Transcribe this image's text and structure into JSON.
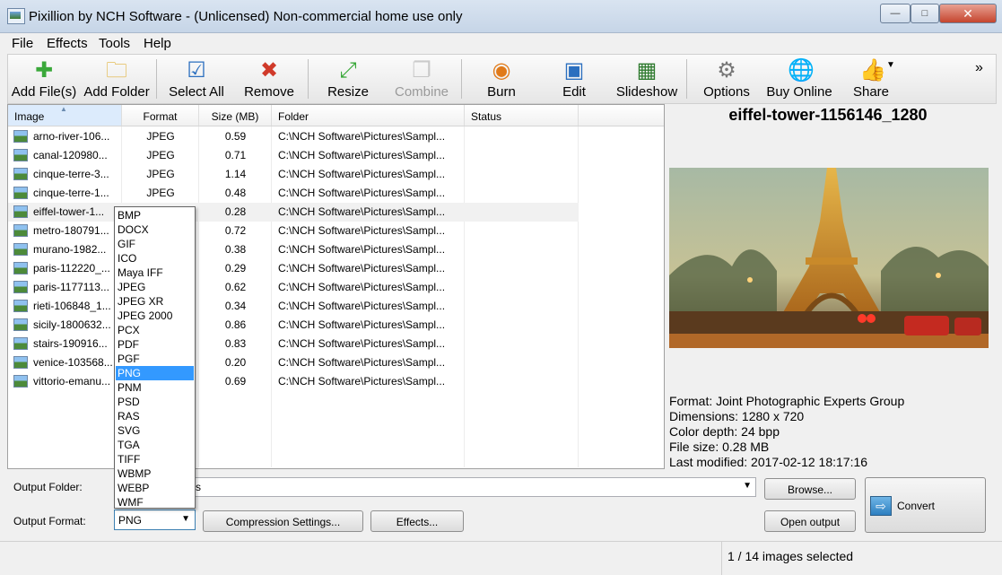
{
  "window": {
    "title": "Pixillion by NCH Software - (Unlicensed) Non-commercial home use only",
    "btn_min": "—",
    "btn_max": "□",
    "btn_close": "✕"
  },
  "menu": [
    "File",
    "Effects",
    "Tools",
    "Help"
  ],
  "toolbar": {
    "items": [
      {
        "label": "Add File(s)",
        "icon": "add-icon",
        "enabled": true
      },
      {
        "label": "Add Folder",
        "icon": "folder-add-icon",
        "enabled": true
      },
      {
        "label": "Select All",
        "icon": "select-all-icon",
        "enabled": true
      },
      {
        "label": "Remove",
        "icon": "remove-icon",
        "enabled": true
      },
      {
        "label": "Resize",
        "icon": "resize-icon",
        "enabled": true
      },
      {
        "label": "Combine",
        "icon": "combine-icon",
        "enabled": false
      },
      {
        "label": "Burn",
        "icon": "burn-disc-icon",
        "enabled": true
      },
      {
        "label": "Edit",
        "icon": "edit-icon",
        "enabled": true
      },
      {
        "label": "Slideshow",
        "icon": "slideshow-icon",
        "enabled": true
      },
      {
        "label": "Options",
        "icon": "options-icon",
        "enabled": true
      },
      {
        "label": "Buy Online",
        "icon": "buy-online-icon",
        "enabled": true
      },
      {
        "label": "Share",
        "icon": "share-icon",
        "enabled": true
      }
    ],
    "overflow": "»"
  },
  "filelist": {
    "columns": [
      "Image",
      "Format",
      "Size (MB)",
      "Folder",
      "Status"
    ],
    "rows": [
      {
        "name": "arno-river-106...",
        "format": "JPEG",
        "size": "0.59",
        "folder": "C:\\NCH Software\\Pictures\\Sampl..."
      },
      {
        "name": "canal-120980...",
        "format": "JPEG",
        "size": "0.71",
        "folder": "C:\\NCH Software\\Pictures\\Sampl..."
      },
      {
        "name": "cinque-terre-3...",
        "format": "JPEG",
        "size": "1.14",
        "folder": "C:\\NCH Software\\Pictures\\Sampl..."
      },
      {
        "name": "cinque-terre-1...",
        "format": "JPEG",
        "size": "0.48",
        "folder": "C:\\NCH Software\\Pictures\\Sampl..."
      },
      {
        "name": "eiffel-tower-1...",
        "format": "",
        "size": "0.28",
        "folder": "C:\\NCH Software\\Pictures\\Sampl..."
      },
      {
        "name": "metro-180791...",
        "format": "",
        "size": "0.72",
        "folder": "C:\\NCH Software\\Pictures\\Sampl..."
      },
      {
        "name": "murano-1982...",
        "format": "",
        "size": "0.38",
        "folder": "C:\\NCH Software\\Pictures\\Sampl..."
      },
      {
        "name": "paris-112220_...",
        "format": "",
        "size": "0.29",
        "folder": "C:\\NCH Software\\Pictures\\Sampl..."
      },
      {
        "name": "paris-1177113...",
        "format": "",
        "size": "0.62",
        "folder": "C:\\NCH Software\\Pictures\\Sampl..."
      },
      {
        "name": "rieti-106848_1...",
        "format": "",
        "size": "0.34",
        "folder": "C:\\NCH Software\\Pictures\\Sampl..."
      },
      {
        "name": "sicily-1800632...",
        "format": "",
        "size": "0.86",
        "folder": "C:\\NCH Software\\Pictures\\Sampl..."
      },
      {
        "name": "stairs-190916...",
        "format": "",
        "size": "0.83",
        "folder": "C:\\NCH Software\\Pictures\\Sampl..."
      },
      {
        "name": "venice-103568...",
        "format": "",
        "size": "0.20",
        "folder": "C:\\NCH Software\\Pictures\\Sampl..."
      },
      {
        "name": "vittorio-emanu...",
        "format": "",
        "size": "0.69",
        "folder": "C:\\NCH Software\\Pictures\\Sampl..."
      }
    ],
    "selected_index": 4
  },
  "preview": {
    "title": "eiffel-tower-1156146_1280",
    "info": [
      "Format: Joint Photographic Experts Group",
      "Dimensions: 1280 x 720",
      "Color depth: 24 bpp",
      "File size: 0.28 MB",
      "Last modified: 2017-02-12 18:17:16"
    ]
  },
  "dropdown": {
    "options": [
      "BMP",
      "DOCX",
      "GIF",
      "ICO",
      "Maya IFF",
      "JPEG",
      "JPEG XR",
      "JPEG 2000",
      "PCX",
      "PDF",
      "PGF",
      "PNG",
      "PNM",
      "PSD",
      "RAS",
      "SVG",
      "TGA",
      "TIFF",
      "WBMP",
      "WEBP",
      "WMF"
    ],
    "highlighted": "PNG"
  },
  "output": {
    "folder_label": "Output Folder:",
    "folder_value_visible": "s",
    "format_label": "Output Format:",
    "format_value": "PNG",
    "browse": "Browse...",
    "open_output": "Open output",
    "compression": "Compression Settings...",
    "effects": "Effects...",
    "convert": "Convert"
  },
  "status": {
    "text": "1 / 14 images selected"
  }
}
